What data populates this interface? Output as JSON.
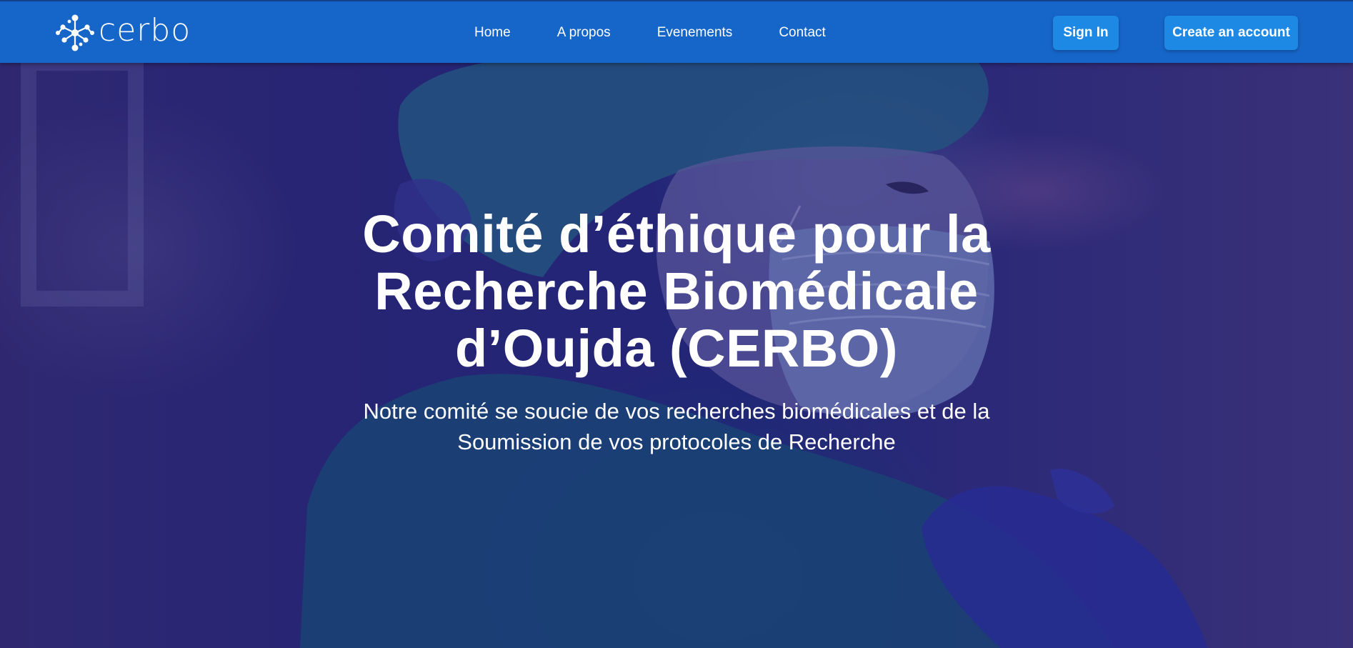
{
  "brand": {
    "name": "cerbo",
    "logo_icon": "molecule-network-icon",
    "color": "#ffffff"
  },
  "nav": {
    "background": "#1665c8",
    "links": [
      {
        "label": "Home"
      },
      {
        "label": "A propos"
      },
      {
        "label": "Evenements"
      },
      {
        "label": "Contact"
      }
    ]
  },
  "auth": {
    "sign_in_label": "Sign In",
    "create_account_label": "Create an account",
    "button_color": "#1e88e5"
  },
  "hero": {
    "title": "Comité d’éthique pour la Recherche Biomédicale d’Oujda (CERBO)",
    "subtitle": "Notre comité se soucie de vos recherches biomédicales et de la Soumission de vos protocoles de Recherche",
    "overlay_color": "#1c1e78",
    "image_subject": "healthcare worker wearing surgical cap and mask"
  }
}
